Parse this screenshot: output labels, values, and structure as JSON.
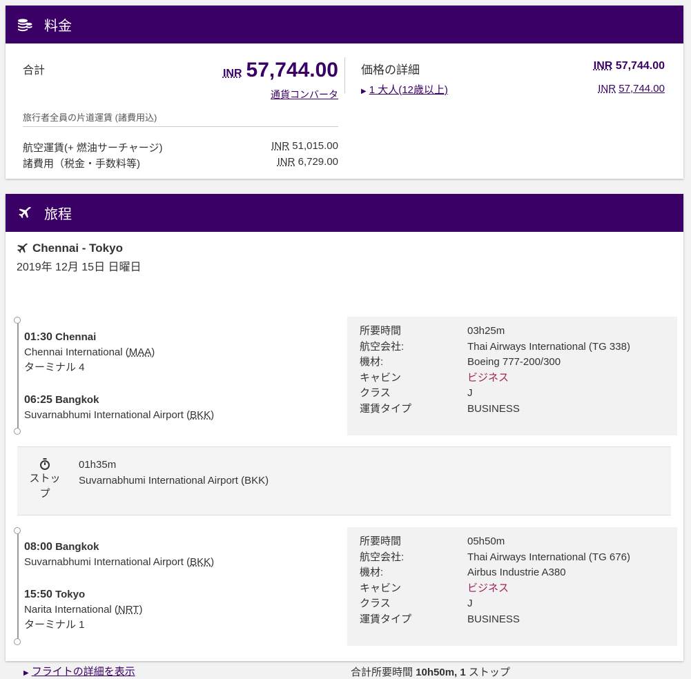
{
  "price": {
    "header_title": "料金",
    "total_label": "合計",
    "total_currency": "INR",
    "total_amount": "57,744.00",
    "currency_converter": "通貨コンバータ",
    "oneway_note": "旅行者全員の片道運賃 (諸費用込)",
    "fees": [
      {
        "label": "航空運賃(+ 燃油サーチャージ)",
        "currency": "INR",
        "amount": "51,015.00"
      },
      {
        "label": "諸費用（税金・手数料等)",
        "currency": "INR",
        "amount": "6,729.00"
      }
    ],
    "details_label": "価格の詳細",
    "details_currency": "INR",
    "details_amount": "57,744.00",
    "adult_label": "1 大人(12歳以上)",
    "adult_currency": "INR",
    "adult_amount": "57,744.00"
  },
  "itinerary": {
    "header_title": "旅程",
    "route": "Chennai - Tokyo",
    "date": "2019年 12月 15日 日曜日",
    "segments": [
      {
        "dep_time": "01:30",
        "dep_city": "Chennai",
        "dep_airport": "Chennai International (",
        "dep_code": "MAA",
        "dep_close": ")",
        "dep_terminal": "ターミナル 4",
        "arr_time": "06:25",
        "arr_city": "Bangkok",
        "arr_airport": "Suvarnabhumi International Airport (",
        "arr_code": "BKK",
        "arr_close": ")",
        "arr_terminal": "",
        "details": {
          "duration_label": "所要時間",
          "duration": "03h25m",
          "airline_label": "航空会社:",
          "airline": "Thai Airways International (TG 338)",
          "aircraft_label": "機材:",
          "aircraft": "Boeing 777-200/300",
          "cabin_label": "キャビン",
          "cabin": "ビジネス",
          "class_label": "クラス",
          "class": "J",
          "fare_label": "運賃タイプ",
          "fare": "BUSINESS"
        }
      },
      {
        "dep_time": "08:00",
        "dep_city": "Bangkok",
        "dep_airport": "Suvarnabhumi International Airport (",
        "dep_code": "BKK",
        "dep_close": ")",
        "dep_terminal": "",
        "arr_time": "15:50",
        "arr_city": "Tokyo",
        "arr_airport": "Narita International (",
        "arr_code": "NRT",
        "arr_close": ")",
        "arr_terminal": "ターミナル 1",
        "details": {
          "duration_label": "所要時間",
          "duration": "05h50m",
          "airline_label": "航空会社:",
          "airline": "Thai Airways International (TG 676)",
          "aircraft_label": "機材:",
          "aircraft": "Airbus Industrie A380",
          "cabin_label": "キャビン",
          "cabin": "ビジネス",
          "class_label": "クラス",
          "class": "J",
          "fare_label": "運賃タイプ",
          "fare": "BUSINESS"
        }
      }
    ],
    "stop": {
      "label_line1": "ストッ",
      "label_line2": "プ",
      "duration": "01h35m",
      "airport": "Suvarnabhumi International Airport (BKK)"
    },
    "flight_details_link": "フライトの詳細を表示",
    "total_prefix": "合計所要時間 ",
    "total_duration": "10h50m,",
    "total_stops_count": " 1",
    "total_stops_label": " ストップ"
  },
  "colors": {
    "header": "#3a0066",
    "cabin": "#a0225a"
  }
}
